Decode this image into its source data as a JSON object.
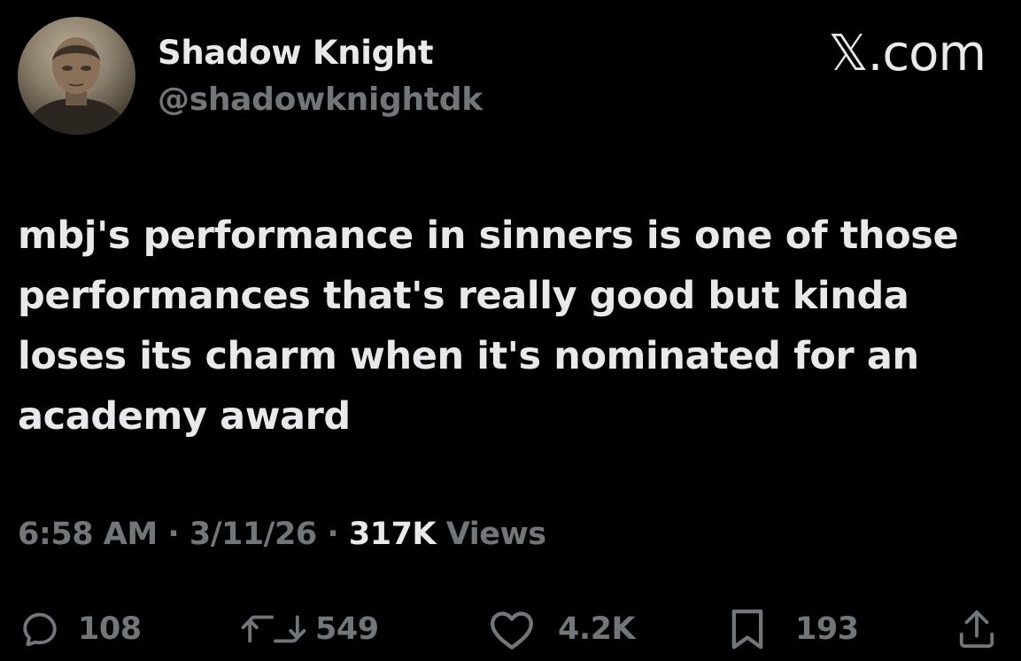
{
  "author": {
    "display_name": "Shadow Knight",
    "handle": "@shadowknightdk",
    "avatar_icon": "user-avatar-photo"
  },
  "source": "𝕏.com",
  "tweet": {
    "text": "mbj's performance in sinners is one of those performances that's really good but kinda loses its charm when it's nominated for an academy award"
  },
  "meta": {
    "time": "6:58 AM",
    "separator": "·",
    "date": "3/11/26",
    "views_count": "317K",
    "views_label": "Views"
  },
  "actions": {
    "replies": "108",
    "reposts": "549",
    "likes": "4.2K",
    "bookmarks": "193"
  },
  "colors": {
    "background": "#000000",
    "primary_text": "#e7e9ea",
    "secondary_text": "#71767b"
  }
}
